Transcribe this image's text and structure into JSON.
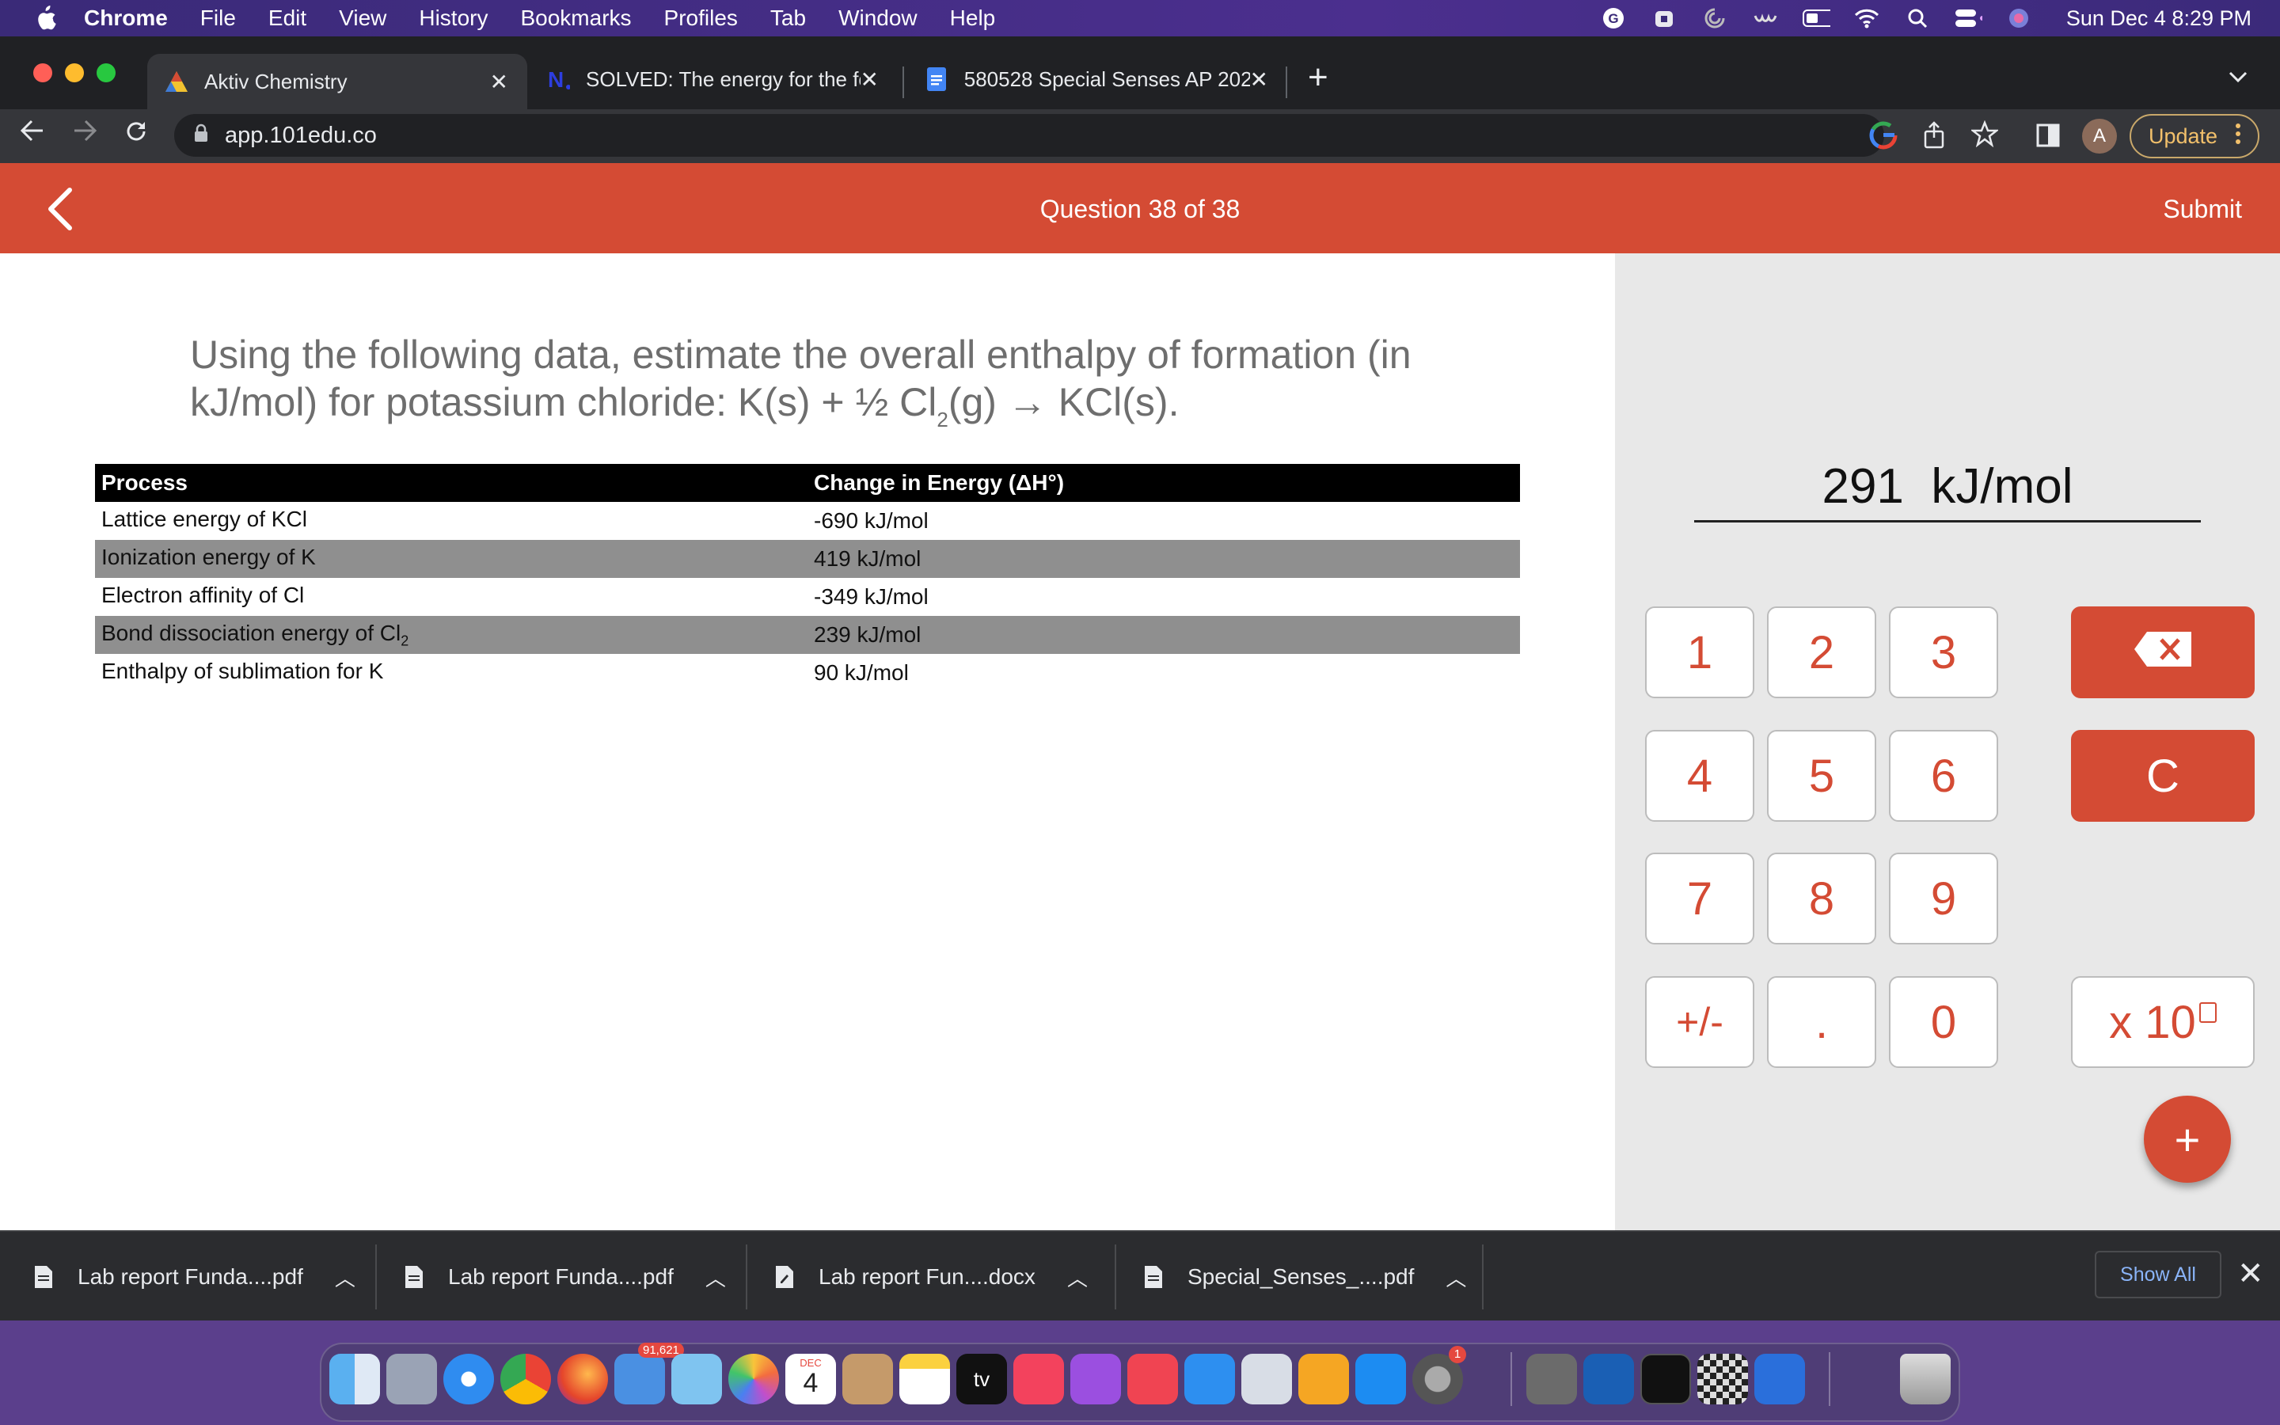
{
  "menubar": {
    "app": "Chrome",
    "items": [
      "File",
      "Edit",
      "View",
      "History",
      "Bookmarks",
      "Profiles",
      "Tab",
      "Window",
      "Help"
    ],
    "clock": "Sun Dec 4  8:29 PM"
  },
  "tabs": [
    {
      "title": "Aktiv Chemistry",
      "icon": "aktiv-logo-icon"
    },
    {
      "title": "SOLVED: The energy for the fol",
      "icon": "numerade-logo-icon"
    },
    {
      "title": "580528 Special Senses AP 202",
      "icon": "google-docs-icon"
    }
  ],
  "address": {
    "url": "app.101edu.co"
  },
  "toolbar": {
    "avatar_letter": "A",
    "update_label": "Update"
  },
  "header": {
    "question_counter": "Question 38 of 38",
    "submit_label": "Submit"
  },
  "question": {
    "text_before": "Using the following data, estimate the overall enthalpy of formation (in kJ/mol) for potassium chloride: K(s) + ½ Cl",
    "sub": "2",
    "text_after": "(g) → KCl(s)."
  },
  "table": {
    "headers": [
      "Process",
      "Change in Energy (ΔH°)"
    ],
    "rows": [
      {
        "process": "Lattice energy of KCl",
        "sub": "",
        "value": "-690 kJ/mol"
      },
      {
        "process": "Ionization energy of K",
        "sub": "",
        "value": "419 kJ/mol"
      },
      {
        "process": "Electron affinity of Cl",
        "sub": "",
        "value": "-349 kJ/mol"
      },
      {
        "process": "Bond dissociation energy of Cl",
        "sub": "2",
        "value": "239 kJ/mol"
      },
      {
        "process": "Enthalpy of sublimation for K",
        "sub": "",
        "value": "90 kJ/mol"
      }
    ]
  },
  "calculator": {
    "answer_value": "291",
    "answer_unit": "kJ/mol",
    "keys": [
      "1",
      "2",
      "3",
      "4",
      "5",
      "6",
      "7",
      "8",
      "9",
      "+/-",
      ".",
      "0"
    ],
    "clear_label": "C",
    "exponent_label": "x 10",
    "fab_label": "+"
  },
  "downloads": {
    "files": [
      "Lab report Funda....pdf",
      "Lab report Funda....pdf",
      "Lab report Fun....docx",
      "Special_Senses_....pdf"
    ],
    "show_all_label": "Show All"
  },
  "dock": {
    "mail_badge": "91,621",
    "calendar_month": "DEC",
    "calendar_day": "4",
    "tv_label": "tv",
    "settings_badge": "1"
  },
  "colors": {
    "accent": "#d44b34",
    "panel": "#e8e8e8",
    "chrome_dark": "#202124"
  }
}
